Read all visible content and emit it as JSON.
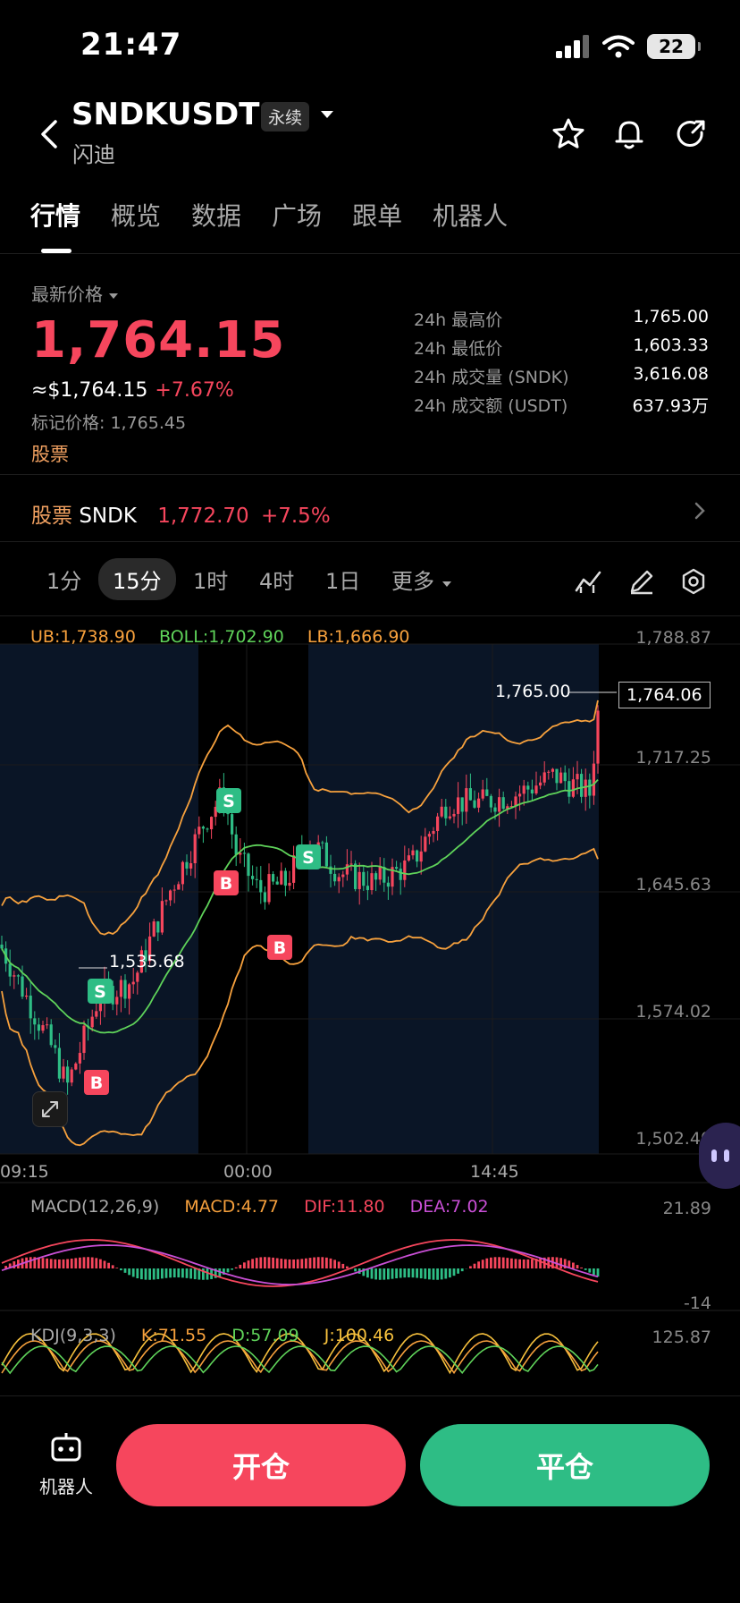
{
  "status": {
    "time": "21:47",
    "battery": "22"
  },
  "header": {
    "symbol": "SNDKUSDT",
    "tag": "永续",
    "subname": "闪迪"
  },
  "tabs": [
    "行情",
    "概览",
    "数据",
    "广场",
    "跟单",
    "机器人"
  ],
  "price": {
    "latest_label": "最新价格",
    "last": "1,764.15",
    "usd": "≈$1,764.15",
    "change": "+7.67%",
    "mark": "标记价格: 1,765.45",
    "stock_link": "股票"
  },
  "stats": [
    {
      "k": "24h 最高价",
      "v": "1,765.00"
    },
    {
      "k": "24h 最低价",
      "v": "1,603.33"
    },
    {
      "k": "24h 成交量 (SNDK)",
      "v": "3,616.08"
    },
    {
      "k": "24h 成交额 (USDT)",
      "v": "637.93万"
    }
  ],
  "ticker": {
    "label": "股票",
    "symbol": "SNDK",
    "price": "1,772.70",
    "change": "+7.5%"
  },
  "intervals": {
    "items": [
      "1分",
      "15分",
      "1时",
      "4时",
      "1日"
    ],
    "more": "更多",
    "selected": "15分"
  },
  "main_chart": {
    "indicators": {
      "ub": "UB:1,738.90",
      "boll": "BOLL:1,702.90",
      "lb": "LB:1,666.90"
    },
    "y_labels": [
      "1,788.87",
      "1,717.25",
      "1,645.63",
      "1,574.02",
      "1,502.40"
    ],
    "x_labels": [
      "09:15",
      "00:00",
      "14:45"
    ],
    "high_marker": "1,765.00",
    "current_marker": "1,764.06",
    "low_marker": "1,535.68",
    "signals": [
      "S",
      "S",
      "S",
      "B",
      "B",
      "B"
    ]
  },
  "macd": {
    "title": "MACD(12,26,9)",
    "macd": "MACD:4.77",
    "dif": "DIF:11.80",
    "dea": "DEA:7.02",
    "y_top": "21.89",
    "y_bottom": "-14"
  },
  "kdj": {
    "title": "KDJ(9,3,3)",
    "k": "K:71.55",
    "d": "D:57.09",
    "j": "J:100.46",
    "y_top": "125.87"
  },
  "bottom": {
    "robot_label": "机器人",
    "open": "开仓",
    "close": "平仓"
  },
  "colors": {
    "up": "#f6465d",
    "down": "#2ebd85",
    "accent": "#f0a060",
    "bg": "#000000"
  }
}
